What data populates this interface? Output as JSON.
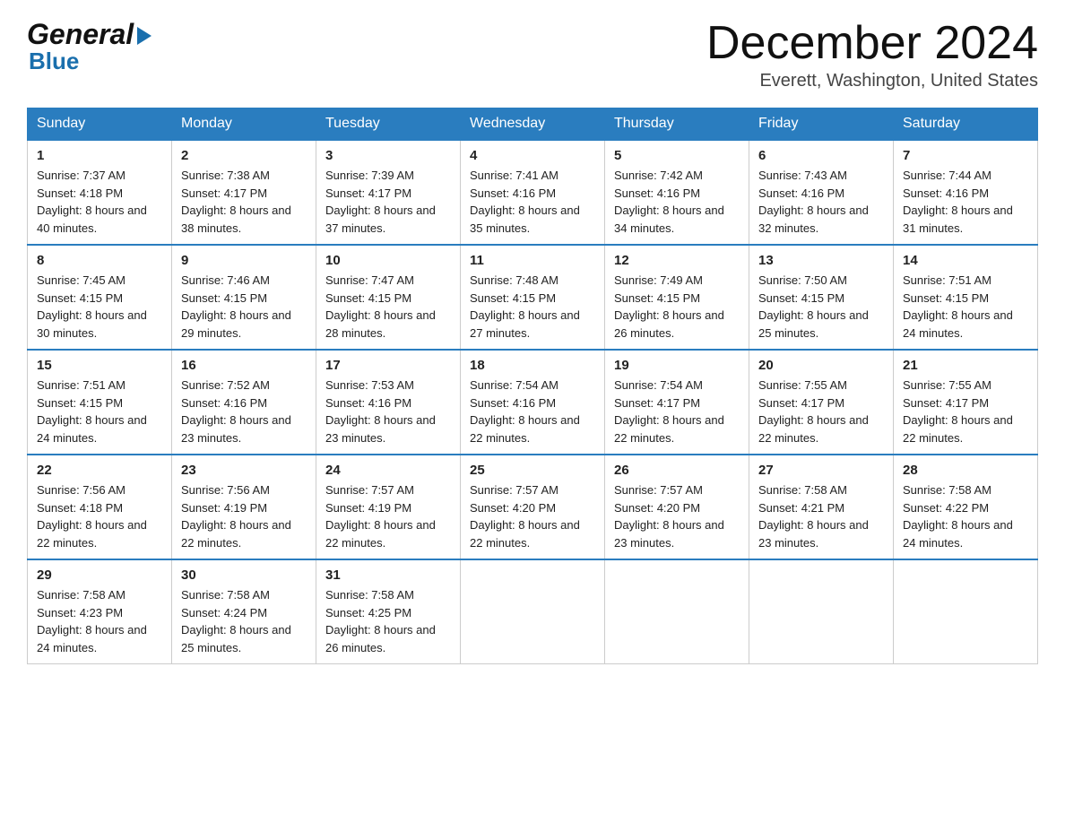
{
  "header": {
    "logo_line1": "General",
    "logo_line2": "Blue",
    "month_title": "December 2024",
    "location": "Everett, Washington, United States"
  },
  "weekdays": [
    "Sunday",
    "Monday",
    "Tuesday",
    "Wednesday",
    "Thursday",
    "Friday",
    "Saturday"
  ],
  "weeks": [
    [
      {
        "day": "1",
        "sunrise": "7:37 AM",
        "sunset": "4:18 PM",
        "daylight": "8 hours and 40 minutes."
      },
      {
        "day": "2",
        "sunrise": "7:38 AM",
        "sunset": "4:17 PM",
        "daylight": "8 hours and 38 minutes."
      },
      {
        "day": "3",
        "sunrise": "7:39 AM",
        "sunset": "4:17 PM",
        "daylight": "8 hours and 37 minutes."
      },
      {
        "day": "4",
        "sunrise": "7:41 AM",
        "sunset": "4:16 PM",
        "daylight": "8 hours and 35 minutes."
      },
      {
        "day": "5",
        "sunrise": "7:42 AM",
        "sunset": "4:16 PM",
        "daylight": "8 hours and 34 minutes."
      },
      {
        "day": "6",
        "sunrise": "7:43 AM",
        "sunset": "4:16 PM",
        "daylight": "8 hours and 32 minutes."
      },
      {
        "day": "7",
        "sunrise": "7:44 AM",
        "sunset": "4:16 PM",
        "daylight": "8 hours and 31 minutes."
      }
    ],
    [
      {
        "day": "8",
        "sunrise": "7:45 AM",
        "sunset": "4:15 PM",
        "daylight": "8 hours and 30 minutes."
      },
      {
        "day": "9",
        "sunrise": "7:46 AM",
        "sunset": "4:15 PM",
        "daylight": "8 hours and 29 minutes."
      },
      {
        "day": "10",
        "sunrise": "7:47 AM",
        "sunset": "4:15 PM",
        "daylight": "8 hours and 28 minutes."
      },
      {
        "day": "11",
        "sunrise": "7:48 AM",
        "sunset": "4:15 PM",
        "daylight": "8 hours and 27 minutes."
      },
      {
        "day": "12",
        "sunrise": "7:49 AM",
        "sunset": "4:15 PM",
        "daylight": "8 hours and 26 minutes."
      },
      {
        "day": "13",
        "sunrise": "7:50 AM",
        "sunset": "4:15 PM",
        "daylight": "8 hours and 25 minutes."
      },
      {
        "day": "14",
        "sunrise": "7:51 AM",
        "sunset": "4:15 PM",
        "daylight": "8 hours and 24 minutes."
      }
    ],
    [
      {
        "day": "15",
        "sunrise": "7:51 AM",
        "sunset": "4:15 PM",
        "daylight": "8 hours and 24 minutes."
      },
      {
        "day": "16",
        "sunrise": "7:52 AM",
        "sunset": "4:16 PM",
        "daylight": "8 hours and 23 minutes."
      },
      {
        "day": "17",
        "sunrise": "7:53 AM",
        "sunset": "4:16 PM",
        "daylight": "8 hours and 23 minutes."
      },
      {
        "day": "18",
        "sunrise": "7:54 AM",
        "sunset": "4:16 PM",
        "daylight": "8 hours and 22 minutes."
      },
      {
        "day": "19",
        "sunrise": "7:54 AM",
        "sunset": "4:17 PM",
        "daylight": "8 hours and 22 minutes."
      },
      {
        "day": "20",
        "sunrise": "7:55 AM",
        "sunset": "4:17 PM",
        "daylight": "8 hours and 22 minutes."
      },
      {
        "day": "21",
        "sunrise": "7:55 AM",
        "sunset": "4:17 PM",
        "daylight": "8 hours and 22 minutes."
      }
    ],
    [
      {
        "day": "22",
        "sunrise": "7:56 AM",
        "sunset": "4:18 PM",
        "daylight": "8 hours and 22 minutes."
      },
      {
        "day": "23",
        "sunrise": "7:56 AM",
        "sunset": "4:19 PM",
        "daylight": "8 hours and 22 minutes."
      },
      {
        "day": "24",
        "sunrise": "7:57 AM",
        "sunset": "4:19 PM",
        "daylight": "8 hours and 22 minutes."
      },
      {
        "day": "25",
        "sunrise": "7:57 AM",
        "sunset": "4:20 PM",
        "daylight": "8 hours and 22 minutes."
      },
      {
        "day": "26",
        "sunrise": "7:57 AM",
        "sunset": "4:20 PM",
        "daylight": "8 hours and 23 minutes."
      },
      {
        "day": "27",
        "sunrise": "7:58 AM",
        "sunset": "4:21 PM",
        "daylight": "8 hours and 23 minutes."
      },
      {
        "day": "28",
        "sunrise": "7:58 AM",
        "sunset": "4:22 PM",
        "daylight": "8 hours and 24 minutes."
      }
    ],
    [
      {
        "day": "29",
        "sunrise": "7:58 AM",
        "sunset": "4:23 PM",
        "daylight": "8 hours and 24 minutes."
      },
      {
        "day": "30",
        "sunrise": "7:58 AM",
        "sunset": "4:24 PM",
        "daylight": "8 hours and 25 minutes."
      },
      {
        "day": "31",
        "sunrise": "7:58 AM",
        "sunset": "4:25 PM",
        "daylight": "8 hours and 26 minutes."
      },
      null,
      null,
      null,
      null
    ]
  ],
  "labels": {
    "sunrise": "Sunrise:",
    "sunset": "Sunset:",
    "daylight": "Daylight:"
  }
}
